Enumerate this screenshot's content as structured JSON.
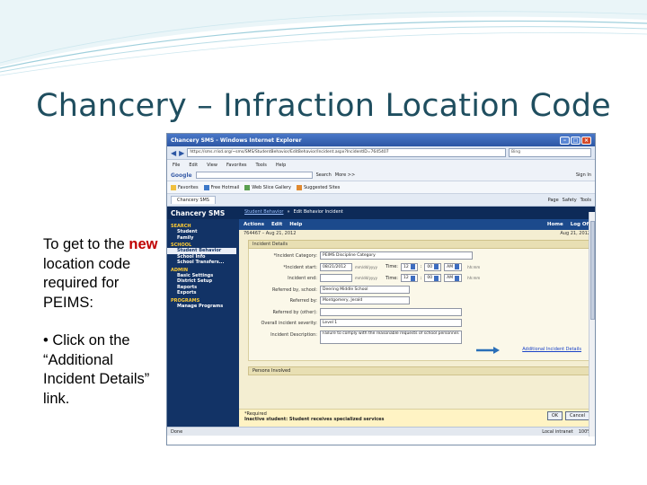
{
  "slide": {
    "title": "Chancery – Infraction Location Code",
    "note1_prefix": "To get to the ",
    "note1_red": "new",
    "note1_suffix": " location code required for PEIMS:",
    "note2": "• Click on the “Additional Incident Details” link.",
    "accent_color": "#c00000",
    "title_color": "#1f4e5f"
  },
  "browser": {
    "title": "Chancery SMS - Windows Internet Explorer",
    "address": "https://sms.rrisd.org/~sms/SMS/StudentBehavior/EditBehavior/Incident.aspx?IncidentID=7645407",
    "search_placeholder": "Bing",
    "menu": [
      "File",
      "Edit",
      "View",
      "Favorites",
      "Tools",
      "Help"
    ],
    "google_label": "Google",
    "google_search": "Search",
    "google_more": "More >>",
    "sign_in": "Sign In",
    "favorites": "Favorites",
    "fav_items": [
      "Free Hotmail",
      "Web Slice Gallery",
      "Suggested Sites"
    ],
    "tab": "Chancery SMS",
    "tools": [
      "Page",
      "Safety",
      "Tools"
    ],
    "status_left": "Done",
    "status_zone": "Local intranet",
    "status_zoom": "100%"
  },
  "app": {
    "logo": "Chancery SMS",
    "breadcrumb_link": "Student Behavior",
    "breadcrumb_current": "Edit Behavior Incident",
    "actions": [
      "Actions",
      "Edit",
      "Help"
    ],
    "home": "Home",
    "logoff": "Log Off",
    "incident_id": "764467 – Aug 21, 2012",
    "date_right": "Aug 21, 2012",
    "sidebar": [
      {
        "head": "SEARCH",
        "items": [
          "Student",
          "Family"
        ]
      },
      {
        "head": "SCHOOL",
        "items": [
          "Student Behavior",
          "School Info",
          "School Transfers..."
        ]
      },
      {
        "head": "ADMIN",
        "items": [
          "Basic Settings",
          "District Setup",
          "Reports",
          "Exports"
        ]
      },
      {
        "head": "PROGRAMS",
        "items": [
          "Manage Programs"
        ]
      }
    ],
    "selected_item": "Student Behavior",
    "panel_title": "Incident Details",
    "fields": {
      "category_label": "*Incident Category:",
      "category_value": "PEIMS Discipline Category",
      "start_label": "*Incident start:",
      "start_value": "08/21/2012",
      "start_hint": "mm/dd/yyyy",
      "end_label": "Incident end:",
      "end_hint": "mm/dd/yyyy",
      "time_label": "Time:",
      "start_hour": "12",
      "start_min": "00",
      "start_ampm": "AM",
      "end_hour": "12",
      "end_min": "00",
      "end_ampm": "AM",
      "time_hint": "hh:mm",
      "referred_school_label": "Referred by, school:",
      "referred_school_value": "Deering Middle School",
      "referred_by_label": "Referred by:",
      "referred_by_value": "Montgomery, Jerald",
      "referred_other_label": "Referred by (other):",
      "severity_label": "Overall incident severity:",
      "severity_value": "Level 1",
      "description_label": "Incident Description:",
      "description_value": "Failure to comply with the reasonable requests of school personnel."
    },
    "additional_link": "Additional Incident Details",
    "persons_title": "Persons Involved",
    "required_note": "*Required",
    "footer_msg": "Inactive student: Student receives specialized services",
    "ok": "OK",
    "cancel": "Cancel"
  }
}
